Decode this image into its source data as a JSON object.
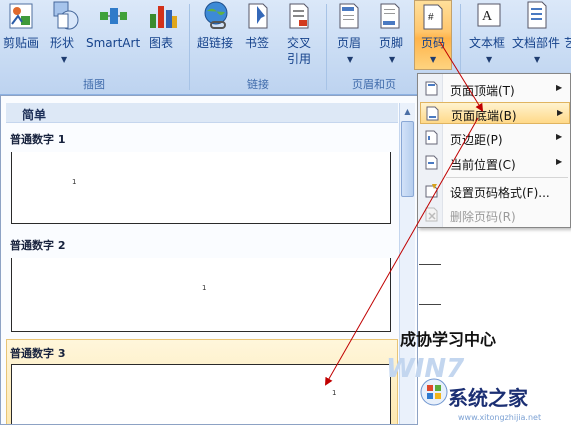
{
  "ribbon": {
    "buttons": {
      "clip_art": "剪贴画",
      "shapes": "形状",
      "smartart": "SmartArt",
      "chart": "图表",
      "hyperlink": "超链接",
      "bookmark": "书签",
      "cross_ref_1": "交叉",
      "cross_ref_2": "引用",
      "header": "页眉",
      "footer": "页脚",
      "page_number": "页码",
      "textbox": "文本框",
      "doc_parts": "文档部件",
      "more": "艺"
    },
    "groups": {
      "illustrations": "插图",
      "links": "链接",
      "header_footer": "页眉和页"
    }
  },
  "gallery": {
    "title": "简单",
    "items": [
      {
        "label": "普通数字 1",
        "number": "1"
      },
      {
        "label": "普通数字 2",
        "number": "1"
      },
      {
        "label": "普通数字 3",
        "number": "1"
      }
    ]
  },
  "menu": {
    "items": [
      {
        "label": "页面顶端(T)",
        "has_submenu": true,
        "state": "normal"
      },
      {
        "label": "页面底端(B)",
        "has_submenu": true,
        "state": "highlighted"
      },
      {
        "label": "页边距(P)",
        "has_submenu": true,
        "state": "normal"
      },
      {
        "label": "当前位置(C)",
        "has_submenu": true,
        "state": "normal"
      },
      {
        "label": "设置页码格式(F)...",
        "has_submenu": false,
        "state": "normal"
      },
      {
        "label": "删除页码(R)",
        "has_submenu": false,
        "state": "disabled"
      }
    ]
  },
  "document": {
    "heading": "成协学习中心"
  },
  "watermark": {
    "brand": "WIN7",
    "site": "系统之家",
    "url": "www.xitongzhijia.net"
  },
  "colors": {
    "ribbon_bg": "#c8dbf3",
    "active_button": "#ffc66d",
    "menu_highlight": "#ffd989",
    "annotation_arrow": "#c00000"
  }
}
